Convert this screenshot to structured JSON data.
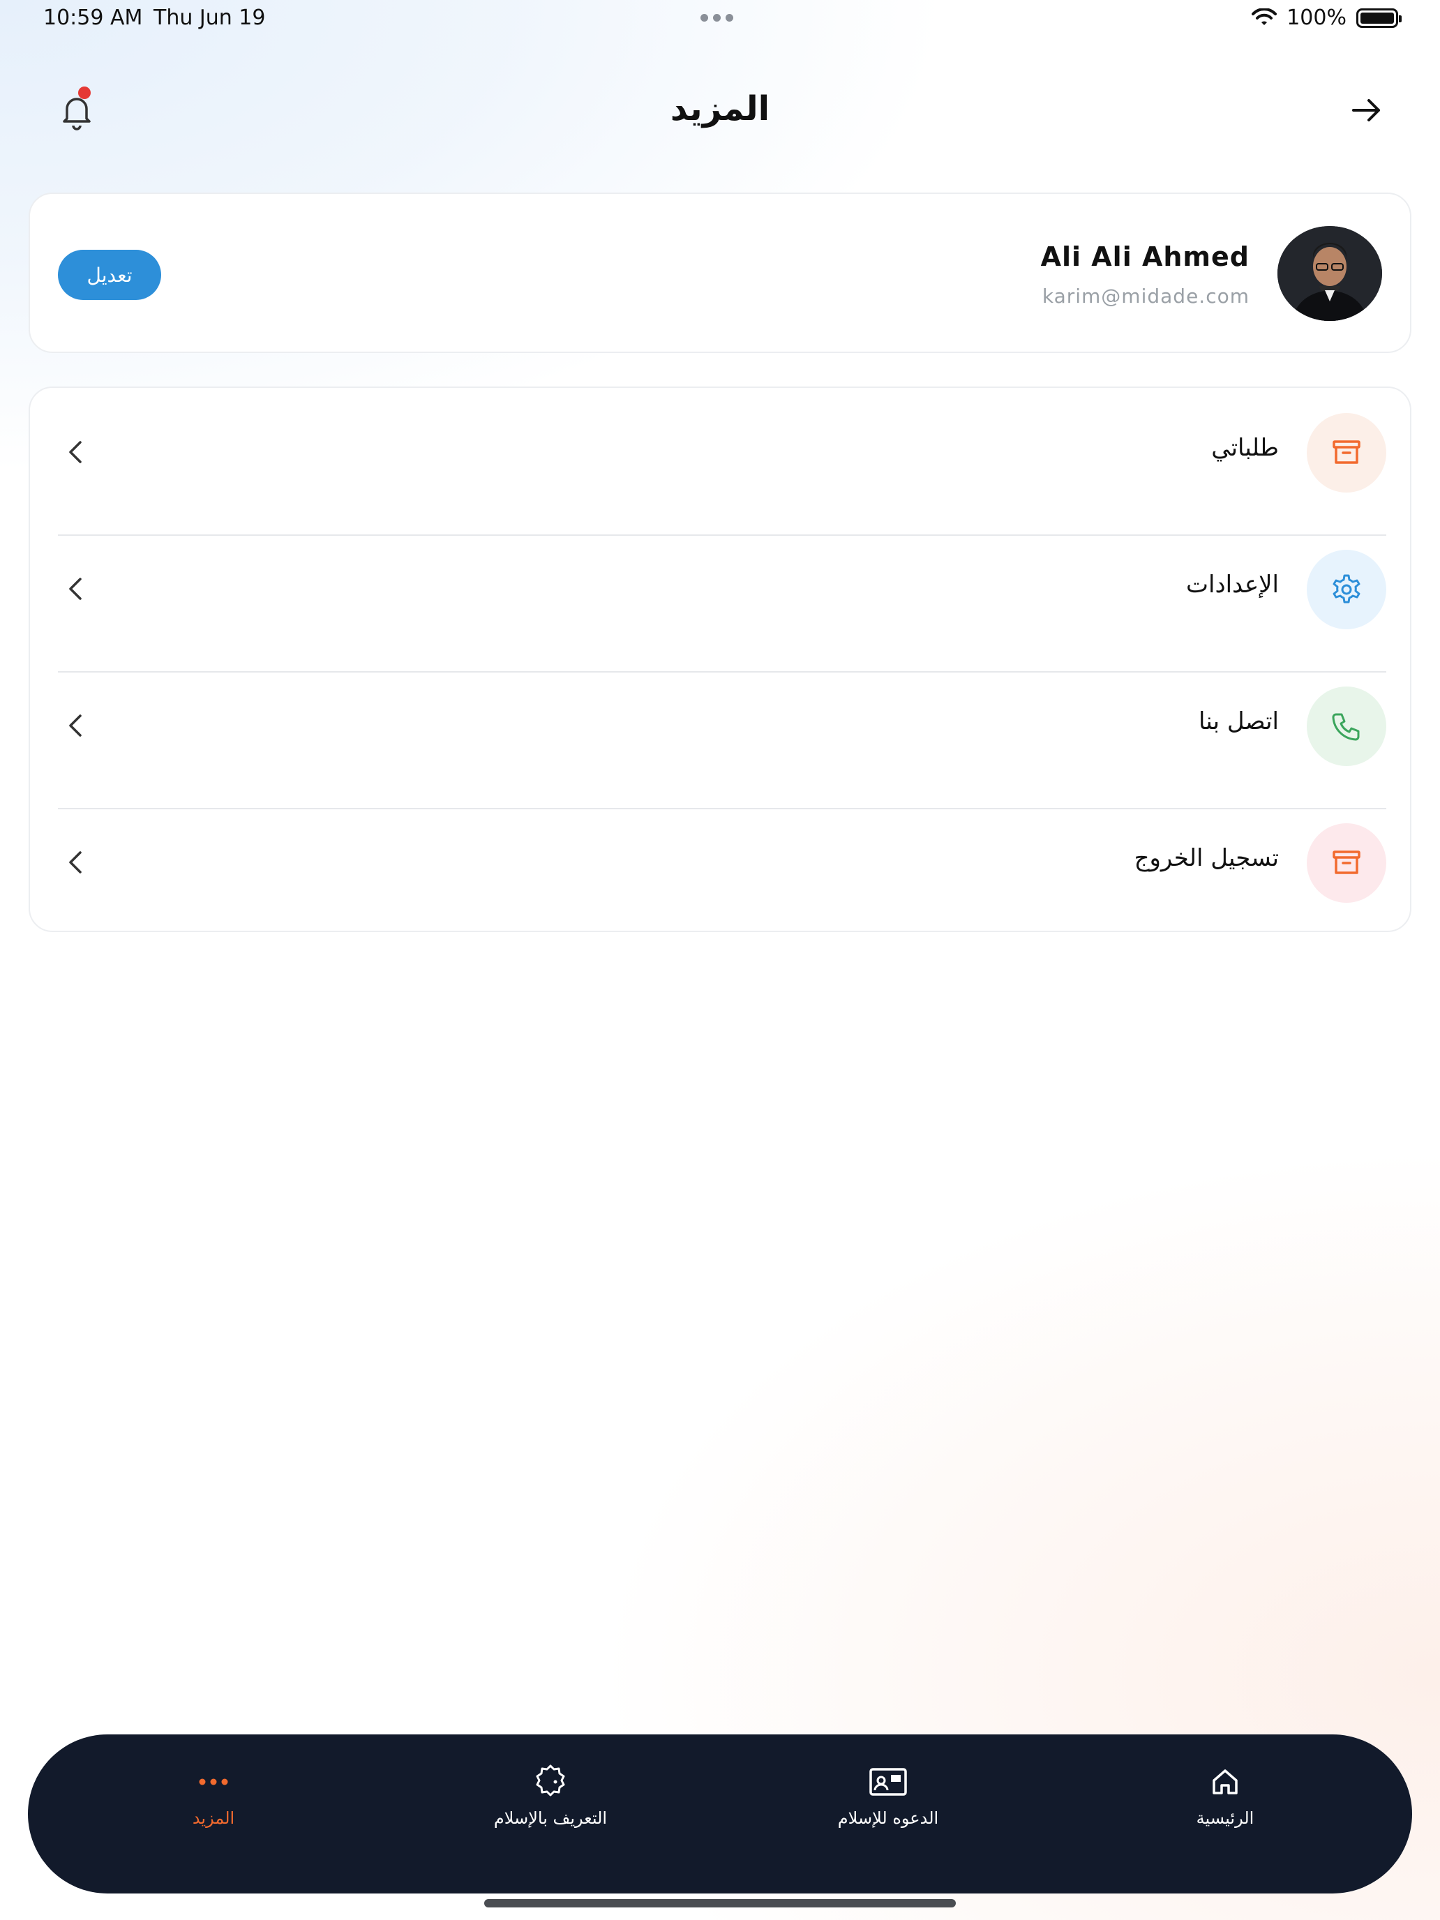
{
  "status_bar": {
    "time": "10:59 AM",
    "date": "Thu Jun 19",
    "battery": "100%"
  },
  "header": {
    "title": "المزيد",
    "notification_icon": "bell-icon",
    "back_icon": "arrow-right-icon"
  },
  "profile": {
    "name": "Ali Ali Ahmed",
    "email": "karim@midade.com",
    "edit_label": "تعديل"
  },
  "menu": {
    "items": [
      {
        "label": "طلباتي",
        "icon": "box-icon",
        "color": "#f26a2e",
        "bg": "#fcefe8"
      },
      {
        "label": "الإعدادات",
        "icon": "gear-icon",
        "color": "#2d8fd9",
        "bg": "#e7f3fd"
      },
      {
        "label": "اتصل بنا",
        "icon": "phone-icon",
        "color": "#3ba55c",
        "bg": "#e8f5ea"
      },
      {
        "label": "تسجيل الخروج",
        "icon": "box-icon",
        "color": "#f26a2e",
        "bg": "#fde9ec"
      }
    ]
  },
  "tabs": [
    {
      "label": "الرئيسية",
      "icon": "home-icon",
      "active": false
    },
    {
      "label": "الدعوه للإسلام",
      "icon": "id-card-icon",
      "active": false
    },
    {
      "label": "التعريف بالإسلام",
      "icon": "crescent-badge-icon",
      "active": false
    },
    {
      "label": "المزيد",
      "icon": "more-dots-icon",
      "active": true
    }
  ],
  "colors": {
    "accent": "#f26a2e",
    "primary": "#2d8fd9",
    "tab_bar": "#121a2b"
  }
}
